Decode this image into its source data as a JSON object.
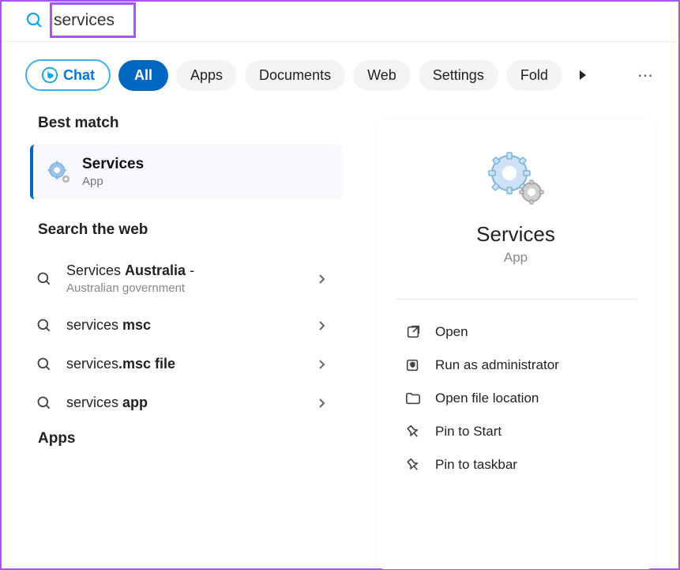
{
  "search": {
    "value": "services"
  },
  "filters": {
    "chat": "Chat",
    "all": "All",
    "apps": "Apps",
    "documents": "Documents",
    "web": "Web",
    "settings": "Settings",
    "folders": "Fold"
  },
  "left": {
    "bestMatchHeader": "Best match",
    "bestMatch": {
      "title": "Services",
      "subtitle": "App"
    },
    "searchWebHeader": "Search the web",
    "webItems": [
      {
        "prefix": "Services ",
        "bold": "Australia",
        "suffix": " -",
        "sub": "Australian government"
      },
      {
        "prefix": "services ",
        "bold": "msc",
        "suffix": "",
        "sub": ""
      },
      {
        "prefix": "services",
        "bold": ".msc file",
        "suffix": "",
        "sub": ""
      },
      {
        "prefix": "services ",
        "bold": "app",
        "suffix": "",
        "sub": ""
      }
    ],
    "appsHeader": "Apps"
  },
  "detail": {
    "title": "Services",
    "subtitle": "App",
    "actions": [
      {
        "icon": "open",
        "label": "Open"
      },
      {
        "icon": "shield",
        "label": "Run as administrator"
      },
      {
        "icon": "folder",
        "label": "Open file location"
      },
      {
        "icon": "pin",
        "label": "Pin to Start"
      },
      {
        "icon": "pin",
        "label": "Pin to taskbar"
      }
    ]
  }
}
